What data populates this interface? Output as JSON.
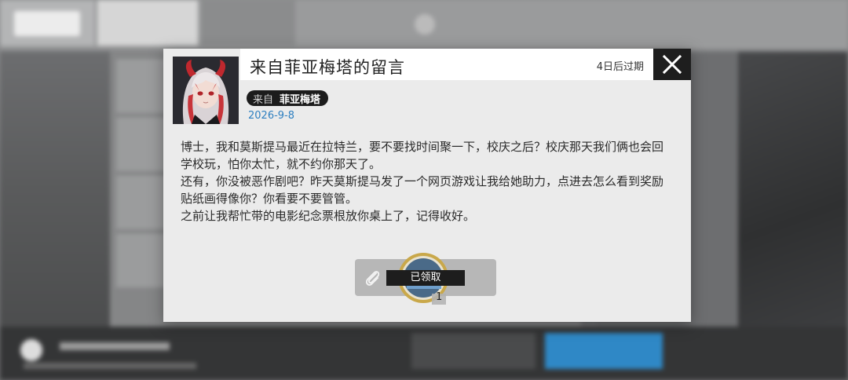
{
  "dialog": {
    "title": "来自菲亚梅塔的留言",
    "expire": "4日后过期",
    "from_label": "来自",
    "from_name": "菲亚梅塔",
    "date": "2026-9-8",
    "body": [
      "博士，我和莫斯提马最近在拉特兰，要不要找时间聚一下，校庆之后？校庆那天我们俩也会回学校玩，怕你太忙，就不约你那天了。",
      "还有，你没被恶作剧吧？昨天莫斯提马发了一个网页游戏让我给她助力，点进去怎么看到奖励贴纸画得像你？你看要不要管管。",
      "之前让我帮忙带的电影纪念票根放你桌上了，记得收好。"
    ],
    "attachment": {
      "status": "已领取",
      "count": "1"
    }
  },
  "icons": {
    "close": "close-icon",
    "attachment": "paperclip-icon"
  },
  "colors": {
    "accent_date": "#2d7fc0",
    "badge_bg": "#1c1c1c",
    "close_bg": "#1e1e1e"
  }
}
